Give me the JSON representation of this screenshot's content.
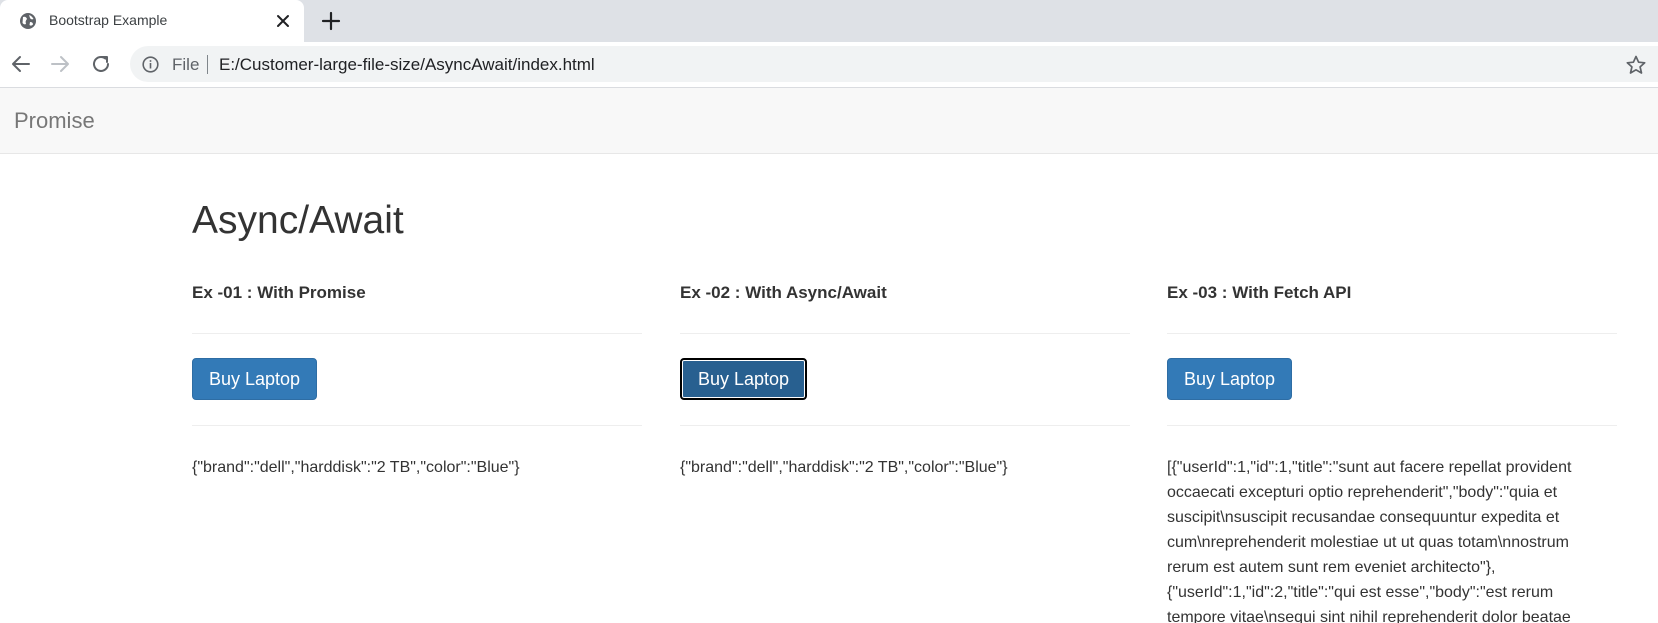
{
  "browser": {
    "tab": {
      "title": "Bootstrap Example",
      "favicon": "globe-icon",
      "close_icon": "close-icon"
    },
    "new_tab_icon": "plus-icon",
    "toolbar": {
      "back_icon": "arrow-left-icon",
      "forward_icon": "arrow-right-icon",
      "reload_icon": "reload-icon",
      "info_icon": "info-icon",
      "scheme_label": "File",
      "url": "E:/Customer-large-file-size/AsyncAwait/index.html",
      "bookmark_icon": "star-icon"
    }
  },
  "navbar": {
    "brand": "Promise"
  },
  "page": {
    "heading": "Async/Await",
    "columns": [
      {
        "title": "Ex -01 : With Promise",
        "button_label": "Buy Laptop",
        "result": "{\"brand\":\"dell\",\"harddisk\":\"2 TB\",\"color\":\"Blue\"}"
      },
      {
        "title": "Ex -02 : With Async/Await",
        "button_label": "Buy Laptop",
        "result": "{\"brand\":\"dell\",\"harddisk\":\"2 TB\",\"color\":\"Blue\"}"
      },
      {
        "title": "Ex -03 : With Fetch API",
        "button_label": "Buy Laptop",
        "result": "[{\"userId\":1,\"id\":1,\"title\":\"sunt aut facere repellat provident occaecati excepturi optio reprehenderit\",\"body\":\"quia et suscipit\\nsuscipit recusandae consequuntur expedita et cum\\nreprehenderit molestiae ut ut quas totam\\nnostrum rerum est autem sunt rem eveniet architecto\"},{\"userId\":1,\"id\":2,\"title\":\"qui est esse\",\"body\":\"est rerum tempore vitae\\nsequi sint nihil reprehenderit dolor beatae"
      }
    ]
  },
  "colors": {
    "primary_button": "#337ab7",
    "focused_button": "#286090",
    "navbar_bg": "#f8f8f8",
    "tabstrip_bg": "#dee1e6"
  }
}
